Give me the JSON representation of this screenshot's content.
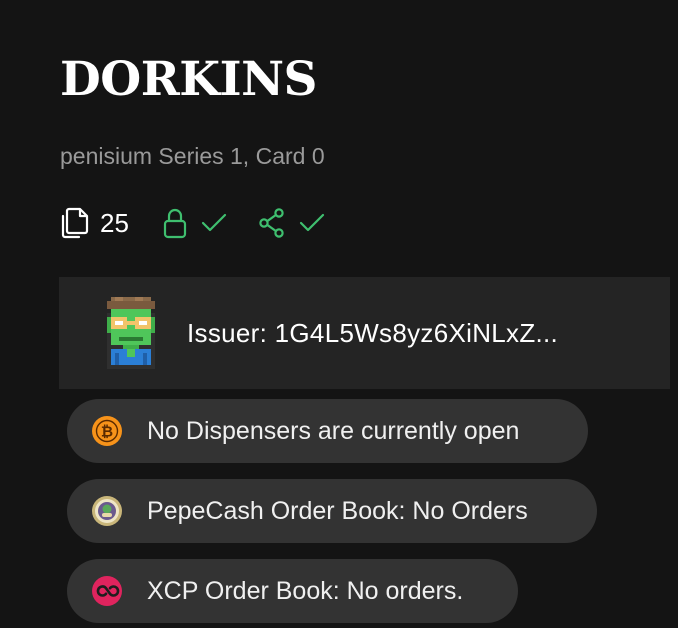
{
  "asset": {
    "name": "DORKINS",
    "subtitle": "penisium Series 1, Card 0"
  },
  "stats": {
    "copies": "25",
    "copies_icon": "copies-icon",
    "locked_icon": "lock-icon",
    "locked_status_icon": "check-icon",
    "divisible_icon": "share-icon",
    "divisible_status_icon": "check-icon",
    "accent_color": "#3fbf6f"
  },
  "issuer": {
    "label": "Issuer: 1G4L5Ws8yz6XiNLxZ...",
    "avatar_icon": "pixel-avatar"
  },
  "markets": [
    {
      "icon": "bitcoin-icon",
      "label": "No Dispensers are currently open",
      "icon_color": "#f7931a"
    },
    {
      "icon": "pepecash-icon",
      "label": "PepeCash Order Book: No Orders",
      "icon_color": "#c9b67a"
    },
    {
      "icon": "xcp-icon",
      "label": "XCP Order Book: No orders.",
      "icon_color": "#e0245e"
    }
  ]
}
